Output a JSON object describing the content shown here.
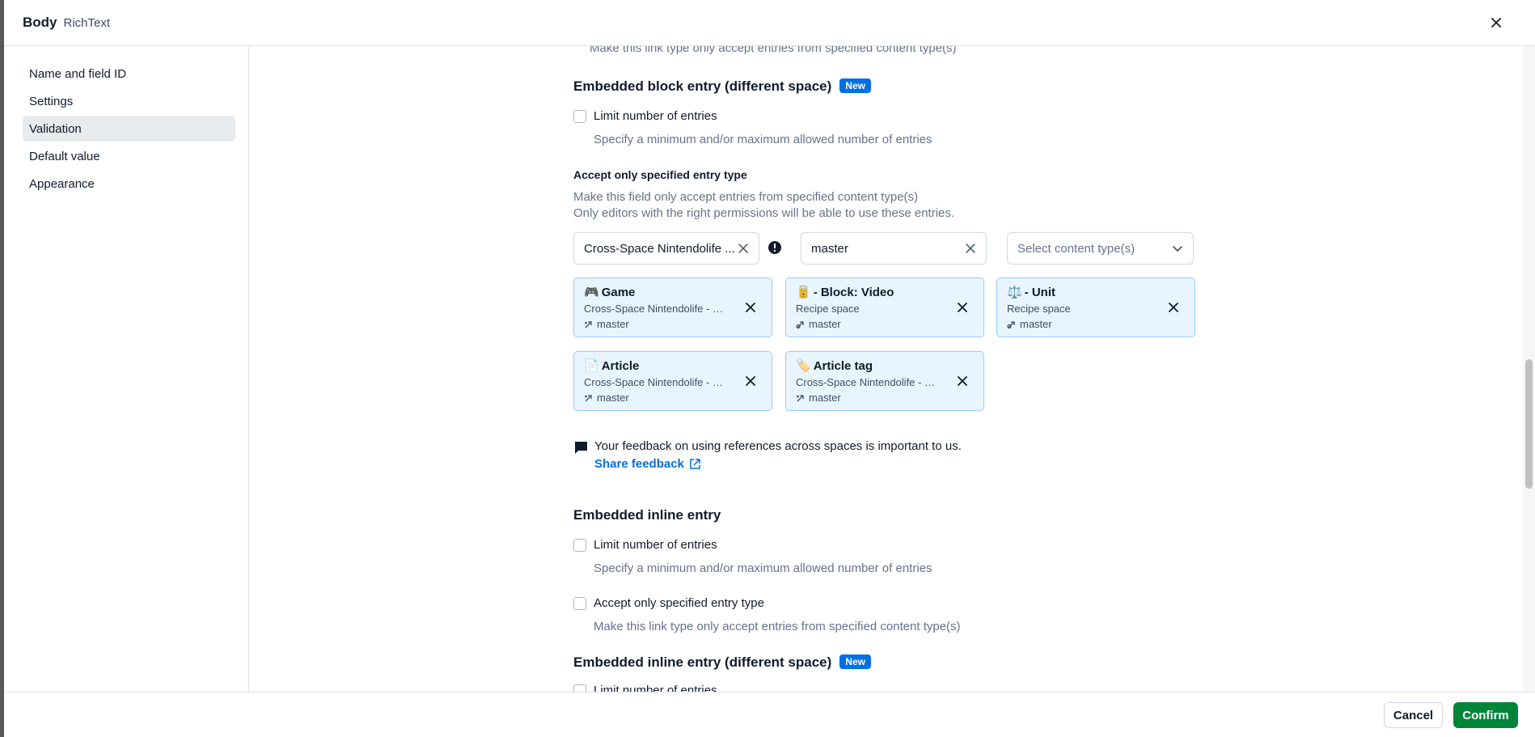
{
  "header": {
    "title": "Body",
    "subtitle": "RichText"
  },
  "sidebar": {
    "items": [
      {
        "label": "Name and field ID",
        "active": false
      },
      {
        "label": "Settings",
        "active": false
      },
      {
        "label": "Validation",
        "active": true
      },
      {
        "label": "Default value",
        "active": false
      },
      {
        "label": "Appearance",
        "active": false
      }
    ]
  },
  "main": {
    "top_text": "Make this link type only accept entries from specified content type(s)",
    "block_diff_space": {
      "title": "Embedded block entry (different space)",
      "badge": "New",
      "limit_label": "Limit number of entries",
      "limit_help": "Specify a minimum and/or maximum allowed number of entries",
      "accept_label": "Accept only specified entry type",
      "accept_help_1": "Make this field only accept entries from specified content type(s)",
      "accept_help_2": "Only editors with the right permissions will be able to use these entries.",
      "space_value": "Cross-Space Nintendolife ...",
      "env_value": "master",
      "content_type_placeholder": "Select content type(s)",
      "cards": [
        {
          "emoji": "🎮",
          "title": "Game",
          "space": "Cross-Space Nintendolife - Embedded",
          "env": "master"
        },
        {
          "emoji": "🥫",
          "title": "- Block: Video",
          "space": "Recipe space",
          "env": "master"
        },
        {
          "emoji": "⚖️",
          "title": "- Unit",
          "space": "Recipe space",
          "env": "master"
        },
        {
          "emoji": "📄",
          "title": "Article",
          "space": "Cross-Space Nintendolife - Embedded",
          "env": "master"
        },
        {
          "emoji": "🏷️",
          "title": "Article tag",
          "space": "Cross-Space Nintendolife - Embedded",
          "env": "master"
        }
      ],
      "feedback_text": "Your feedback on using references across spaces is important to us.",
      "feedback_link": "Share feedback"
    },
    "inline_entry": {
      "title": "Embedded inline entry",
      "limit_label": "Limit number of entries",
      "limit_help": "Specify a minimum and/or maximum allowed number of entries",
      "accept_label": "Accept only specified entry type",
      "accept_help": "Make this link type only accept entries from specified content type(s)"
    },
    "inline_diff_space": {
      "title": "Embedded inline entry (different space)",
      "badge": "New",
      "limit_label": "Limit number of entries"
    }
  },
  "footer": {
    "cancel_label": "Cancel",
    "confirm_label": "Confirm"
  },
  "colors": {
    "primary": "#036fe3",
    "confirm": "#008539",
    "card_bg": "#e8f5ff",
    "card_border": "#98cbff"
  }
}
